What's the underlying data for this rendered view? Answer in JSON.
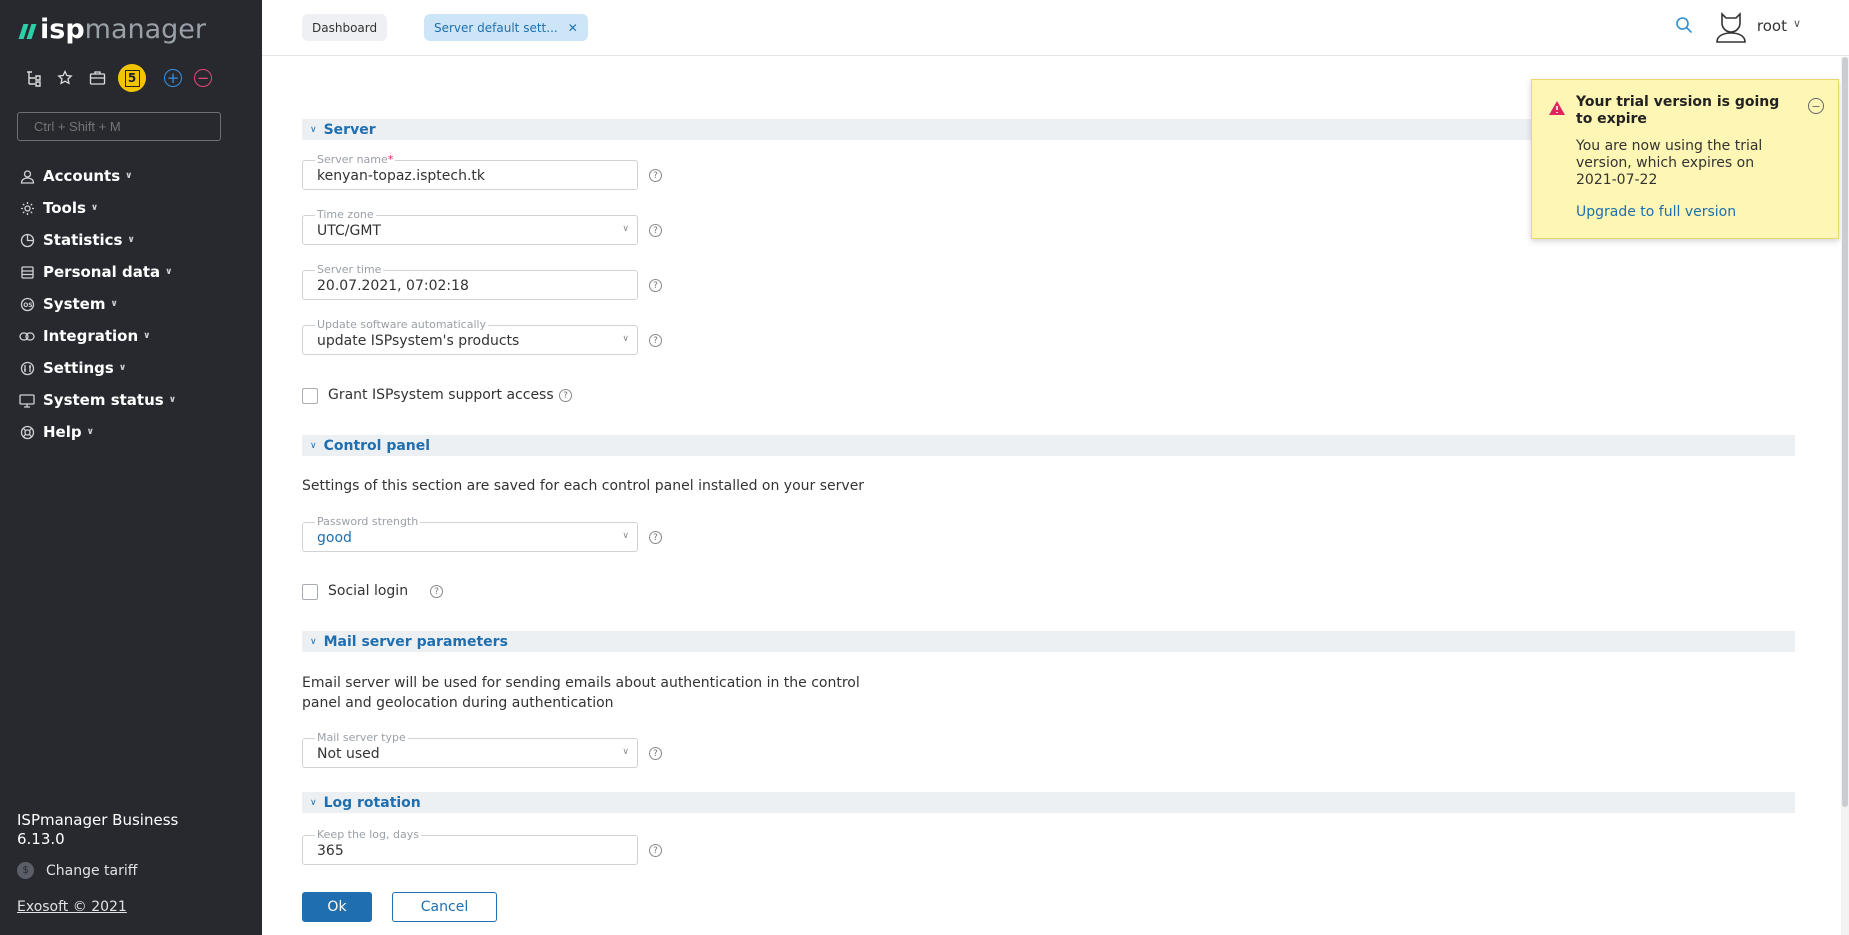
{
  "app": {
    "logo_bold": "isp",
    "logo_light": "manager",
    "product": "ISPmanager Business 6.13.0",
    "change_tariff": "Change tariff",
    "copyright": "Exosoft © 2021"
  },
  "toolbar": {
    "badge": "5",
    "plus": "+",
    "minus": "−"
  },
  "search": {
    "placeholder": "Ctrl + Shift + M"
  },
  "nav": {
    "items": [
      {
        "label": "Accounts"
      },
      {
        "label": "Tools"
      },
      {
        "label": "Statistics"
      },
      {
        "label": "Personal data"
      },
      {
        "label": "System"
      },
      {
        "label": "Integration"
      },
      {
        "label": "Settings"
      },
      {
        "label": "System status"
      },
      {
        "label": "Help"
      }
    ]
  },
  "header": {
    "tabs": [
      {
        "label": "Dashboard"
      },
      {
        "label": "Server default sett..."
      }
    ],
    "username": "root"
  },
  "form": {
    "sections": {
      "server": "Server",
      "control_panel": "Control panel",
      "mail": "Mail server parameters",
      "log": "Log rotation"
    },
    "server_name": {
      "label": "Server name",
      "required": "*",
      "value": "kenyan-topaz.isptech.tk"
    },
    "time_zone": {
      "label": "Time zone",
      "value": "UTC/GMT"
    },
    "server_time": {
      "label": "Server time",
      "value": "20.07.2021, 07:02:18"
    },
    "update": {
      "label": "Update software automatically",
      "value": "update ISPsystem's products"
    },
    "grant_access": {
      "label": "Grant ISPsystem support access"
    },
    "control_panel_desc": "Settings of this section are saved for each control panel installed on your server",
    "password_strength": {
      "label": "Password strength",
      "value": "good"
    },
    "social_login": {
      "label": "Social login"
    },
    "mail_desc": "Email server will be used for sending emails about authentication in the control panel and geolocation during authentication",
    "mail_type": {
      "label": "Mail server type",
      "value": "Not used"
    },
    "keep_log": {
      "label": "Keep the log, days",
      "value": "365"
    },
    "help_glyph": "?",
    "ok": "Ok",
    "cancel": "Cancel"
  },
  "notice": {
    "title": "Your trial version is going to expire",
    "text": "You are now using the trial version, which expires on 2021-07-22",
    "link": "Upgrade to full version"
  },
  "colors": {
    "sidebar": "#27292f",
    "accent": "#1f6fb0",
    "badge": "#f2c500",
    "notice": "#fdf6b4"
  }
}
